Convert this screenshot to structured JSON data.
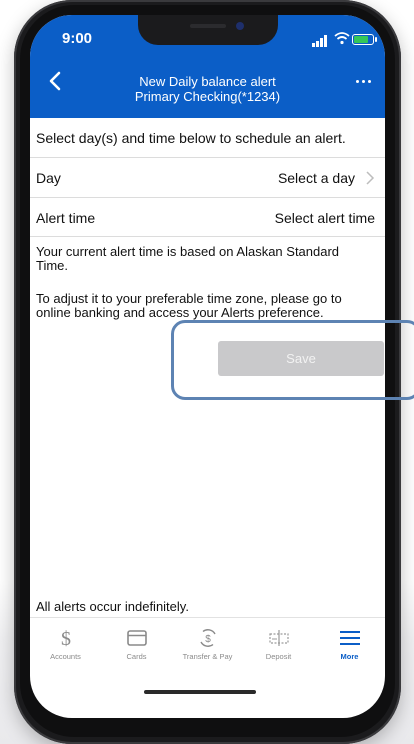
{
  "status_bar": {
    "time": "9:00"
  },
  "header": {
    "title": "New Daily balance alert",
    "subtitle": "Primary Checking(*1234)"
  },
  "form": {
    "intro": "Select day(s) and time below to schedule an alert.",
    "day_label": "Day",
    "day_value": "Select a day",
    "time_label": "Alert time",
    "time_value": "Select alert time",
    "timezone_note": "Your current alert time is based on Alaskan Standard Time.",
    "adjust_note": "To adjust it to your preferable time zone, please go to online banking and access your Alerts preference.",
    "save_label": "Save",
    "footnote": "All alerts occur indefinitely."
  },
  "tabs": [
    {
      "label": "Accounts",
      "icon": "dollar-icon"
    },
    {
      "label": "Cards",
      "icon": "card-icon"
    },
    {
      "label": "Transfer & Pay",
      "icon": "transfer-icon"
    },
    {
      "label": "Deposit",
      "icon": "check-deposit-icon"
    },
    {
      "label": "More",
      "icon": "menu-icon"
    }
  ],
  "colors": {
    "header_bg": "#0b5ec7",
    "active_tab": "#0b5ec7",
    "save_disabled": "#c9c9cb",
    "highlight_ring": "#5d83b3"
  }
}
